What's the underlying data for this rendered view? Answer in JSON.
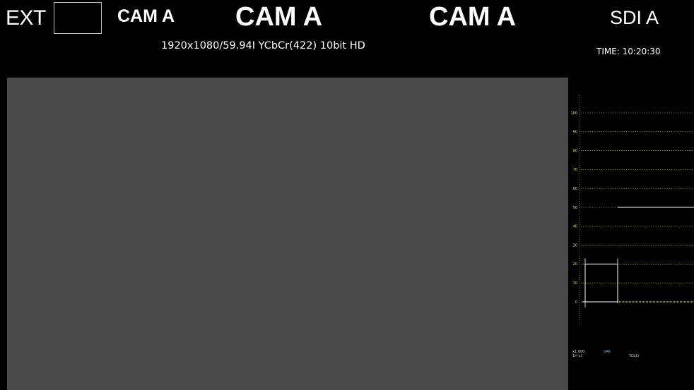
{
  "header": {
    "sync_label": "EXT",
    "cam_small": "CAM A",
    "cam_center": "CAM A",
    "cam_right": "CAM A",
    "input_label": "SDI A",
    "format": "1920x1080/59.94I YCbCr(422) 10bit HD",
    "time": "TIME: 10:20:30"
  },
  "waveform": {
    "ticks": [
      "100",
      "90",
      "80",
      "70",
      "60",
      "50",
      "40",
      "30",
      "20",
      "10",
      "0"
    ],
    "scale": "x1.000",
    "sweep": "1H x1",
    "mode": "VAR",
    "color_system": "YCbCr",
    "colors": {
      "graticule": "#e8e060",
      "trace": "#ffffff",
      "mode_text": "#4fb7e6"
    }
  }
}
